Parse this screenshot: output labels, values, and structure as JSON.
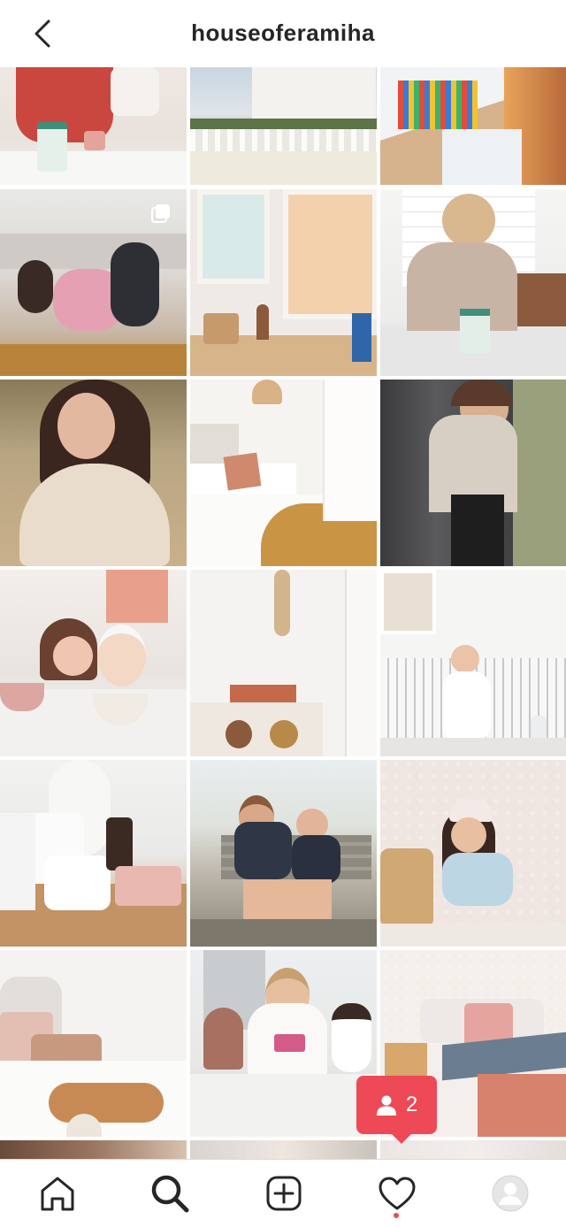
{
  "header": {
    "title": "houseoferamiha",
    "back_icon": "chevron-left-icon"
  },
  "notification": {
    "icon": "person-icon",
    "count": "2"
  },
  "tabbar": {
    "items": [
      {
        "name": "home",
        "icon": "home-icon"
      },
      {
        "name": "search",
        "icon": "search-icon",
        "active": true
      },
      {
        "name": "new-post",
        "icon": "add-post-icon"
      },
      {
        "name": "activity",
        "icon": "heart-icon",
        "has_unread_dot": true
      },
      {
        "name": "profile",
        "icon": "avatar"
      }
    ]
  },
  "colors": {
    "accent_red": "#ed4956",
    "text_dark": "#262626",
    "divider": "#dbdbdb"
  }
}
